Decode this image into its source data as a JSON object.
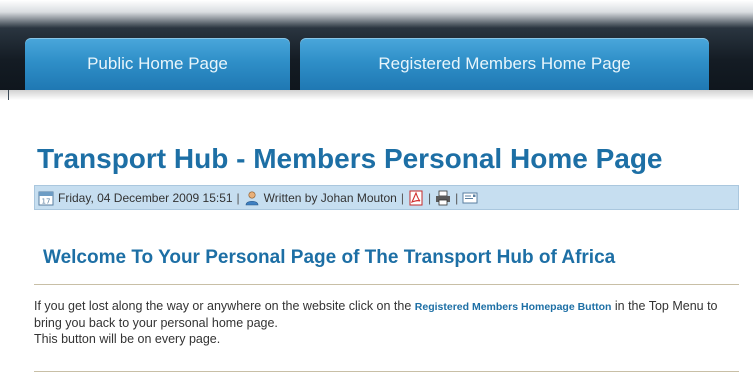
{
  "nav": {
    "tabs": [
      {
        "label": "Public Home Page"
      },
      {
        "label": "Registered Members Home Page"
      }
    ]
  },
  "article": {
    "title": "Transport Hub - Members Personal Home Page",
    "meta": {
      "date": "Friday, 04 December 2009 15:51",
      "author": "Written by Johan Mouton",
      "separator": "|"
    },
    "heading": "Welcome To Your Personal Page of The Transport Hub of Africa",
    "body": {
      "part1": "If you get lost along the way or anywhere on the website click on the ",
      "link": "Registered Members Homepage Button",
      "part2": " in the Top Menu to bring you back to your personal home page.",
      "line2": "This button will be on every page."
    }
  },
  "colors": {
    "accent": "#1d6fa5",
    "tab": "#2f8fc8",
    "meta_bar": "#c6def0",
    "topbar": "#141c24"
  },
  "icons": [
    "calendar-icon",
    "user-icon",
    "pdf-icon",
    "print-icon",
    "email-icon"
  ]
}
